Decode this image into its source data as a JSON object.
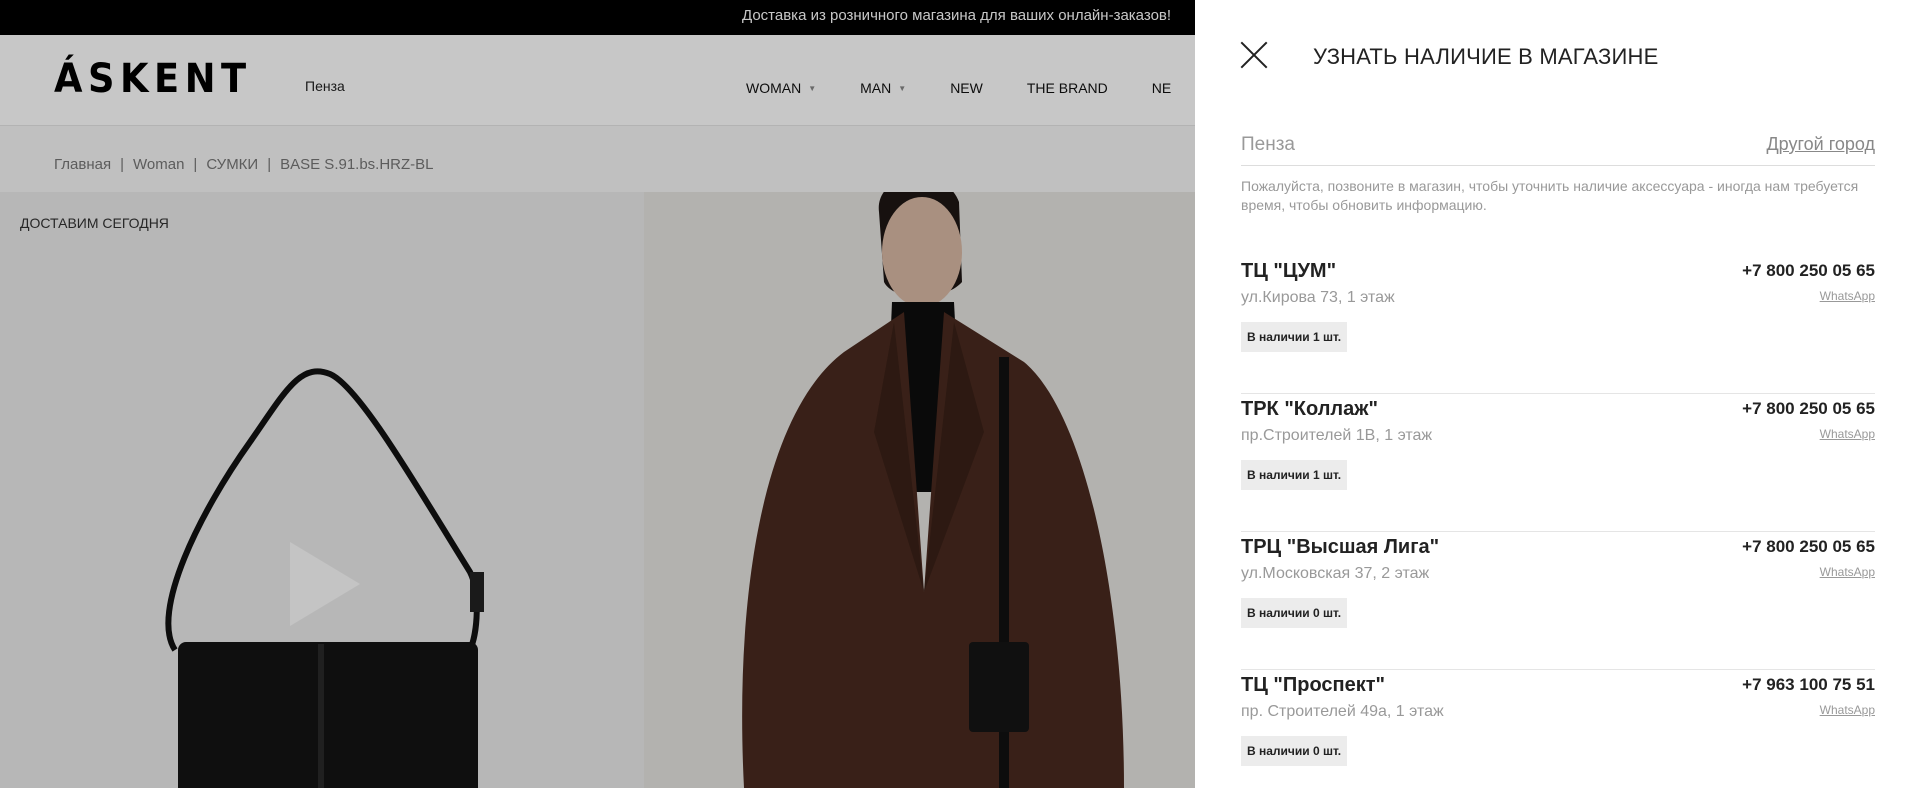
{
  "announcement": "Доставка из розничного магазина для ваших онлайн-заказов!",
  "header": {
    "logo": "ÁSKENT",
    "city": "Пенза",
    "nav": [
      {
        "label": "WOMAN",
        "has_caret": true
      },
      {
        "label": "MAN",
        "has_caret": true
      },
      {
        "label": "NEW",
        "has_caret": false
      },
      {
        "label": "THE BRAND",
        "has_caret": false
      },
      {
        "label": "NE",
        "has_caret": false
      }
    ]
  },
  "breadcrumb": [
    "Главная",
    "Woman",
    "СУМКИ",
    "BASE S.91.bs.HRZ-BL"
  ],
  "breadcrumb_sep": "|",
  "gallery": {
    "delivery_label": "ДОСТАВИМ СЕГОДНЯ"
  },
  "panel": {
    "title": "УЗНАТЬ НАЛИЧИЕ В МАГАЗИНЕ",
    "city": "Пенза",
    "other_city": "Другой город",
    "notice": "Пожалуйста, позвоните в магазин, чтобы уточнить наличие аксессуара - иногда нам требуется время, чтобы обновить информацию.",
    "stores": [
      {
        "name": "ТЦ \"ЦУМ\"",
        "address": "ул.Кирова 73, 1 этаж",
        "stock": "В наличии 1 шт.",
        "phone": "+7 800 250 05 65",
        "whatsapp": "WhatsApp"
      },
      {
        "name": "ТРК \"Коллаж\"",
        "address": "пр.Строителей 1В, 1 этаж",
        "stock": "В наличии 1 шт.",
        "phone": "+7 800 250 05 65",
        "whatsapp": "WhatsApp"
      },
      {
        "name": "ТРЦ \"Высшая Лига\"",
        "address": "ул.Московская 37, 2 этаж",
        "stock": "В наличии 0 шт.",
        "phone": "+7 800 250 05 65",
        "whatsapp": "WhatsApp"
      },
      {
        "name": "ТЦ \"Проспект\"",
        "address": "пр. Строителей 49а, 1 этаж",
        "stock": "В наличии 0 шт.",
        "phone": "+7 963 100 75 51",
        "whatsapp": "WhatsApp"
      }
    ]
  }
}
